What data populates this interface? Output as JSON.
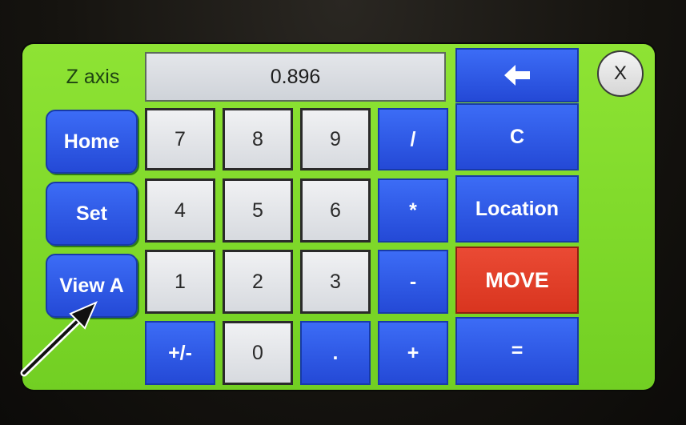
{
  "axis_label": "Z axis",
  "display_value": "0.896",
  "close_label": "X",
  "side_buttons": {
    "home": "Home",
    "set": "Set",
    "view_a": "View A"
  },
  "keypad": {
    "seven": "7",
    "eight": "8",
    "nine": "9",
    "four": "4",
    "five": "5",
    "six": "6",
    "one": "1",
    "two": "2",
    "three": "3",
    "plus_minus": "+/-",
    "zero": "0",
    "dot": "."
  },
  "operators": {
    "divide": "/",
    "multiply": "*",
    "minus": "-",
    "plus": "+"
  },
  "right_buttons": {
    "clear": "C",
    "location": "Location",
    "move": "MOVE",
    "equals": "="
  },
  "icons": {
    "backspace": "left-arrow",
    "pointer": "arrow-pointer"
  },
  "colors": {
    "screen_green": "#7fd92a",
    "key_blue": "#2d58e6",
    "move_red": "#e04129",
    "key_white": "#e2e4e8"
  }
}
